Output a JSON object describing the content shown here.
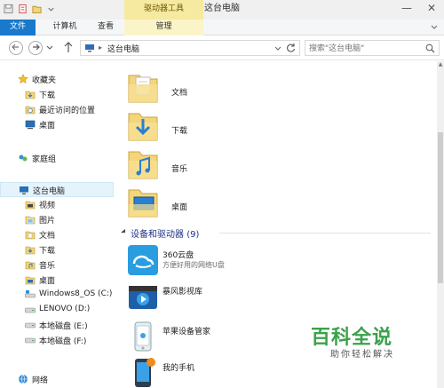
{
  "window": {
    "title": "这台电脑",
    "context_tab_group": "驱动器工具",
    "minimize": "—",
    "close": "✕"
  },
  "ribbon": {
    "tabs": [
      "文件",
      "计算机",
      "查看",
      "管理"
    ],
    "collapse_icon": "chevron-down-icon"
  },
  "address": {
    "crumb": "这台电脑",
    "separator": "▸"
  },
  "search": {
    "placeholder": "搜索\"这台电脑\""
  },
  "nav_pane": {
    "favorites": {
      "label": "收藏夹",
      "items": [
        "下载",
        "最近访问的位置",
        "桌面"
      ]
    },
    "homegroup": "家庭组",
    "this_pc": {
      "label": "这台电脑",
      "items": [
        "视频",
        "图片",
        "文档",
        "下载",
        "音乐",
        "桌面",
        "Windows8_OS (C:)",
        "LENOVO (D:)",
        "本地磁盘 (E:)",
        "本地磁盘 (F:)"
      ]
    },
    "network": "网络"
  },
  "folders": [
    "文档",
    "下载",
    "音乐",
    "桌面"
  ],
  "devices_section": {
    "title": "设备和驱动器",
    "count": "(9)",
    "items": [
      {
        "name": "360云盘",
        "desc": "方便好用的网络U盘"
      },
      {
        "name": "暴风影视库",
        "desc": ""
      },
      {
        "name": "苹果设备管家",
        "desc": ""
      },
      {
        "name": "我的手机",
        "desc": ""
      }
    ]
  },
  "watermark": {
    "title": "百科全说",
    "subtitle": "助你轻松解决"
  },
  "colors": {
    "file_tab": "#1979ca",
    "context_tab": "#f6e9a0",
    "section_title": "#1e3287",
    "selection": "#e5f3fb",
    "folder": "#f4d57a",
    "watermark": "#3aa24b"
  }
}
